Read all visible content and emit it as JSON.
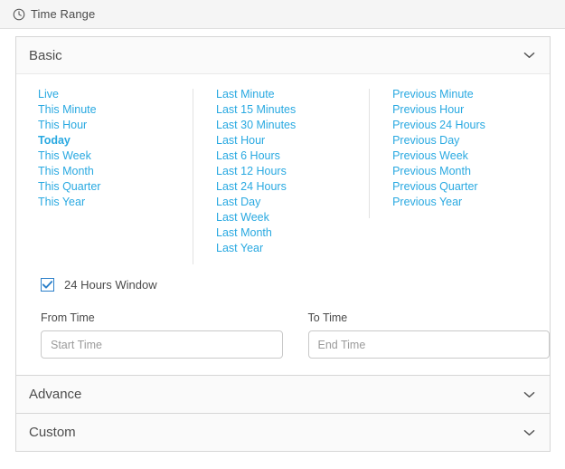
{
  "titlebar": {
    "icon": "clock-icon",
    "title": "Time Range"
  },
  "sections": {
    "basic": {
      "title": "Basic",
      "chevron": "chevron-down-icon",
      "expanded": true
    },
    "advance": {
      "title": "Advance",
      "chevron": "chevron-down-icon",
      "expanded": false
    },
    "custom": {
      "title": "Custom",
      "chevron": "chevron-down-icon",
      "expanded": false
    }
  },
  "quick_ranges": {
    "column1": [
      {
        "label": "Live",
        "selected": false
      },
      {
        "label": "This Minute",
        "selected": false
      },
      {
        "label": "This Hour",
        "selected": false
      },
      {
        "label": "Today",
        "selected": true
      },
      {
        "label": "This Week",
        "selected": false
      },
      {
        "label": "This Month",
        "selected": false
      },
      {
        "label": "This Quarter",
        "selected": false
      },
      {
        "label": "This Year",
        "selected": false
      }
    ],
    "column2": [
      {
        "label": "Last Minute",
        "selected": false
      },
      {
        "label": "Last 15 Minutes",
        "selected": false
      },
      {
        "label": "Last 30 Minutes",
        "selected": false
      },
      {
        "label": "Last Hour",
        "selected": false
      },
      {
        "label": "Last 6 Hours",
        "selected": false
      },
      {
        "label": "Last 12 Hours",
        "selected": false
      },
      {
        "label": "Last 24 Hours",
        "selected": false
      },
      {
        "label": "Last Day",
        "selected": false
      },
      {
        "label": "Last Week",
        "selected": false
      },
      {
        "label": "Last Month",
        "selected": false
      },
      {
        "label": "Last Year",
        "selected": false
      }
    ],
    "column3": [
      {
        "label": "Previous Minute",
        "selected": false
      },
      {
        "label": "Previous Hour",
        "selected": false
      },
      {
        "label": "Previous 24 Hours",
        "selected": false
      },
      {
        "label": "Previous Day",
        "selected": false
      },
      {
        "label": "Previous Week",
        "selected": false
      },
      {
        "label": "Previous Month",
        "selected": false
      },
      {
        "label": "Previous Quarter",
        "selected": false
      },
      {
        "label": "Previous Year",
        "selected": false
      }
    ]
  },
  "window_checkbox": {
    "label": "24 Hours Window",
    "checked": true
  },
  "from_time": {
    "label": "From Time",
    "value": "",
    "placeholder": "Start Time"
  },
  "to_time": {
    "label": "To Time",
    "value": "",
    "placeholder": "End Time"
  },
  "colors": {
    "link": "#29a9e1",
    "checkbox": "#2a7fc9",
    "titlebar_bg": "#f5f5f5",
    "panel_header_bg": "#fafafa",
    "border": "#d6d6d6"
  }
}
